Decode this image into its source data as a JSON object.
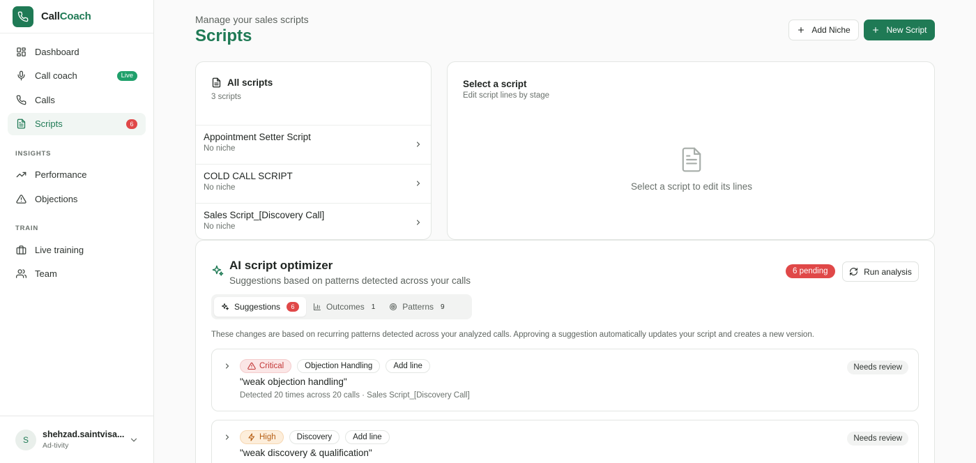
{
  "brand": {
    "part1": "Call",
    "part2": "Coach"
  },
  "nav": {
    "items": [
      {
        "label": "Dashboard",
        "icon": "layout-grid-icon"
      },
      {
        "label": "Call coach",
        "icon": "microphone-icon",
        "badge": "Live"
      },
      {
        "label": "Calls",
        "icon": "phone-icon"
      },
      {
        "label": "Scripts",
        "icon": "document-icon",
        "badge": "6"
      }
    ],
    "insights_label": "INSIGHTS",
    "insights": [
      {
        "label": "Performance",
        "icon": "trending-up-icon"
      },
      {
        "label": "Objections",
        "icon": "alert-triangle-icon"
      }
    ],
    "train_label": "TRAIN",
    "train": [
      {
        "label": "Live training",
        "icon": "briefcase-icon"
      },
      {
        "label": "Team",
        "icon": "users-icon"
      }
    ]
  },
  "user": {
    "initial": "S",
    "name": "shehzad.saintvisa...",
    "org": "Ad-tivity"
  },
  "header": {
    "subtitle": "Manage your sales scripts",
    "title": "Scripts",
    "add_niche": "Add Niche",
    "new_script": "New Script"
  },
  "scripts_panel": {
    "title": "All scripts",
    "count": "3 scripts",
    "items": [
      {
        "name": "Appointment Setter Script",
        "niche": "No niche"
      },
      {
        "name": "COLD CALL SCRIPT",
        "niche": "No niche"
      },
      {
        "name": "Sales Script_[Discovery Call]",
        "niche": "No niche"
      }
    ]
  },
  "editor": {
    "title": "Select a script",
    "subtitle": "Edit script lines by stage",
    "empty_text": "Select a script to edit its lines"
  },
  "optimizer": {
    "title": "AI script optimizer",
    "subtitle": "Suggestions based on patterns detected across your calls",
    "pending": "6 pending",
    "run_label": "Run analysis",
    "tabs": [
      {
        "label": "Suggestions",
        "count": "6"
      },
      {
        "label": "Outcomes",
        "count": "1"
      },
      {
        "label": "Patterns",
        "count": "9"
      }
    ],
    "note": "These changes are based on recurring patterns detected across your analyzed calls. Approving a suggestion automatically updates your script and creates a new version.",
    "suggestions": [
      {
        "severity": "Critical",
        "category": "Objection Handling",
        "action": "Add line",
        "quote": "\"weak objection handling\"",
        "meta": "Detected 20 times across 20 calls · Sales Script_[Discovery Call]",
        "status": "Needs review"
      },
      {
        "severity": "High",
        "category": "Discovery",
        "action": "Add line",
        "quote": "\"weak discovery & qualification\"",
        "meta": "",
        "status": "Needs review"
      }
    ]
  },
  "colors": {
    "brand": "#1f7a55",
    "danger": "#e04848",
    "live": "#1fa06b"
  }
}
